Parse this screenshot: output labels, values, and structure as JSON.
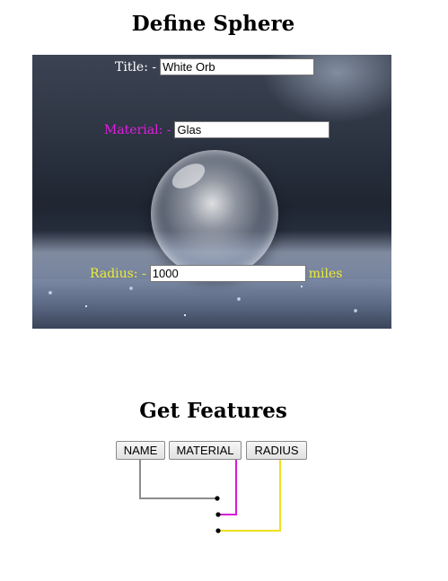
{
  "define": {
    "heading": "Define Sphere"
  },
  "fields": {
    "title": {
      "label": "Title: -",
      "value": "White Orb",
      "color": "#ffffff"
    },
    "material": {
      "label": "Material: -",
      "value": "Glas",
      "color": "#e01ee0"
    },
    "radius": {
      "label": "Radius: -",
      "value": "1000",
      "unit": "miles",
      "color": "#ecec33"
    }
  },
  "features": {
    "heading": "Get Features",
    "buttons": {
      "name": "NAME",
      "material": "MATERIAL",
      "radius": "RADIUS"
    },
    "wire_colors": {
      "name": "#8c8c8c",
      "material": "#d81ad8",
      "radius": "#f0e020"
    }
  }
}
